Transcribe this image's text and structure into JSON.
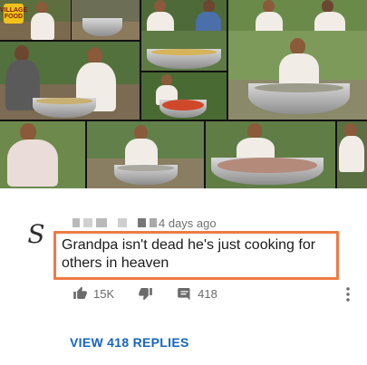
{
  "video": {
    "channel_logo_text": "VILLAGE\nFOOD"
  },
  "comment": {
    "author_initial": "S",
    "timestamp": "4 days ago",
    "text": "Grandpa isn't dead he's just cooking for others in heaven",
    "likes": "15K",
    "reply_count": "418",
    "view_replies_label": "VIEW 418 REPLIES"
  },
  "colors": {
    "highlight_border": "#ee7a45",
    "link_blue": "#1565c0",
    "icon_gray": "#6b6b6b"
  },
  "icons": [
    "thumbs-up-icon",
    "thumbs-down-icon",
    "reply-comment-icon",
    "more-vert-icon"
  ]
}
